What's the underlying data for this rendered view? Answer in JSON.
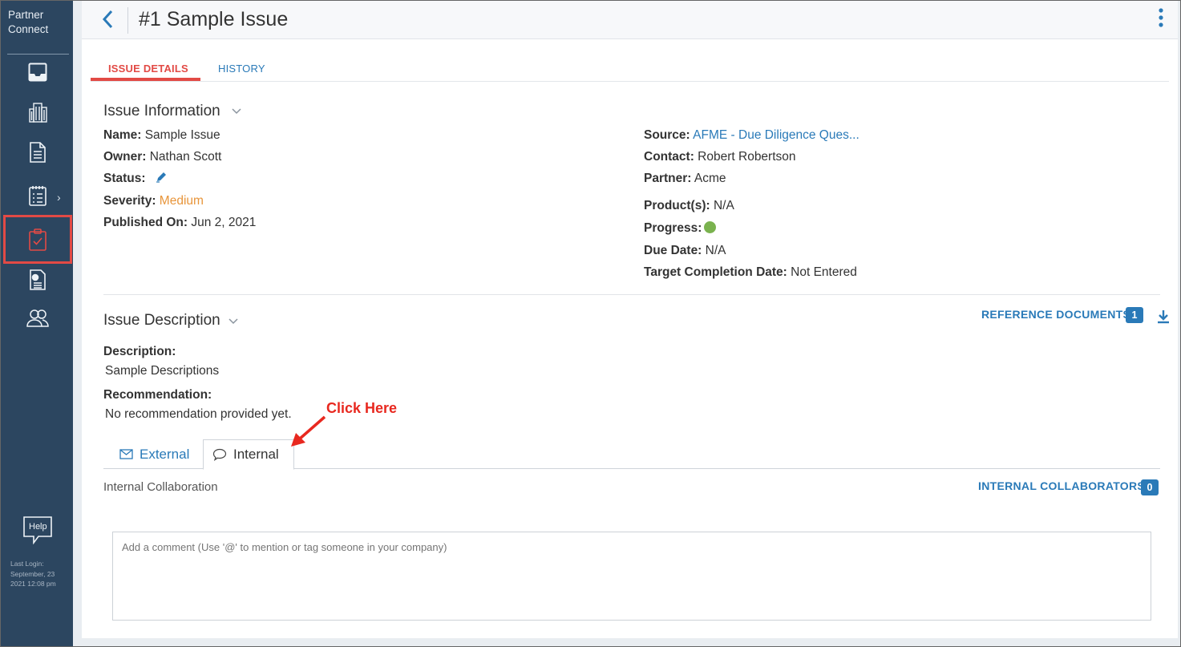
{
  "sidebar": {
    "brand_line1": "Partner",
    "brand_line2": "Connect",
    "help_label": "Help",
    "last_login_label": "Last Login:",
    "last_login_date": "September, 23",
    "last_login_time": "2021 12:08 pm"
  },
  "header": {
    "title": "#1 Sample Issue"
  },
  "tabs": [
    {
      "label": "ISSUE DETAILS",
      "active": true
    },
    {
      "label": "HISTORY",
      "active": false
    }
  ],
  "issue_info": {
    "section_title": "Issue Information",
    "name_label": "Name:",
    "name_value": "Sample Issue",
    "owner_label": "Owner:",
    "owner_value": "Nathan Scott",
    "status_label": "Status:",
    "severity_label": "Severity:",
    "severity_value": "Medium",
    "published_label": "Published On:",
    "published_value": "Jun 2, 2021",
    "source_label": "Source:",
    "source_value": "AFME - Due Diligence Ques...",
    "contact_label": "Contact:",
    "contact_value": "Robert Robertson",
    "partner_label": "Partner:",
    "partner_value": "Acme",
    "products_label": "Product(s):",
    "products_value": "N/A",
    "progress_label": "Progress:",
    "due_label": "Due Date:",
    "due_value": "N/A",
    "target_label": "Target Completion Date:",
    "target_value": "Not Entered"
  },
  "issue_desc": {
    "section_title": "Issue Description",
    "reference_label": "REFERENCE DOCUMENTS",
    "reference_count": "1",
    "description_label": "Description:",
    "description_value": "Sample Descriptions",
    "recommendation_label": "Recommendation:",
    "recommendation_value": "No recommendation provided yet."
  },
  "collab": {
    "tab_external": "External",
    "tab_internal": "Internal",
    "section_label": "Internal Collaboration",
    "collaborators_label": "INTERNAL COLLABORATORS",
    "collaborators_count": "0",
    "comment_placeholder": "Add a comment (Use '@' to mention or tag someone in your company)"
  },
  "annotation": {
    "text": "Click Here"
  },
  "colors": {
    "sidebar": "#2c4660",
    "accent": "#2a7ab8",
    "active_red": "#e24a45",
    "severity_orange": "#e8953a",
    "progress_green": "#7ab24e"
  }
}
